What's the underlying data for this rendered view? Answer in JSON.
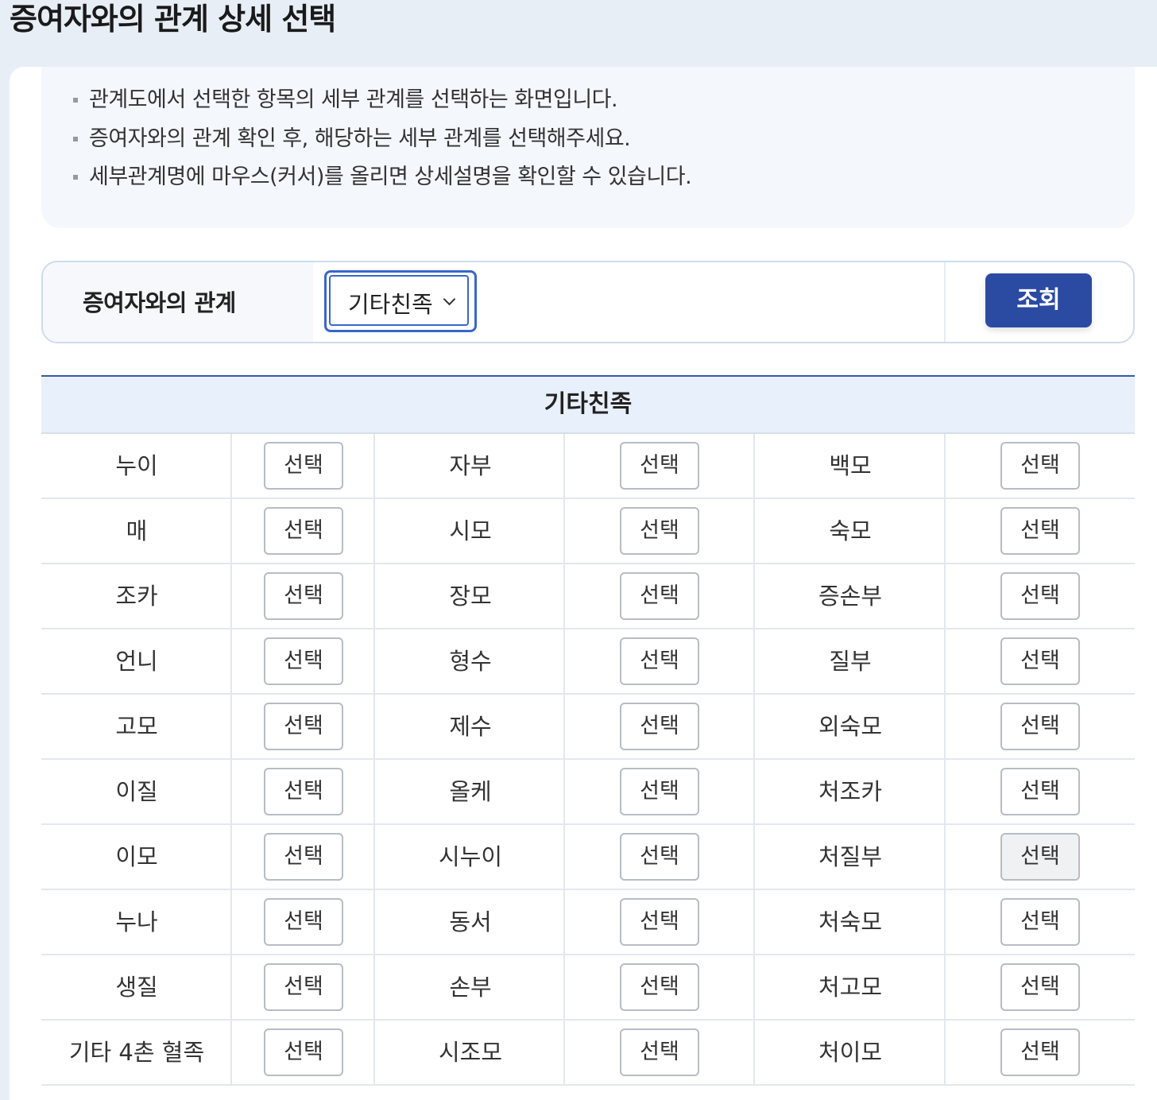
{
  "page": {
    "title": "증여자와의 관계 상세 선택"
  },
  "guide": {
    "items": [
      "관계도에서 선택한 항목의 세부 관계를 선택하는 화면입니다.",
      "증여자와의 관계 확인 후, 해당하는 세부 관계를 선택해주세요.",
      "세부관계명에 마우스(커서)를 올리면 상세설명을 확인할 수 있습니다."
    ]
  },
  "search": {
    "label": "증여자와의 관계",
    "select_value": "기타친족",
    "button_label": "조회"
  },
  "table": {
    "header": "기타친족",
    "select_label": "선택",
    "rows": [
      [
        "누이",
        "자부",
        "백모"
      ],
      [
        "매",
        "시모",
        "숙모"
      ],
      [
        "조카",
        "장모",
        "증손부"
      ],
      [
        "언니",
        "형수",
        "질부"
      ],
      [
        "고모",
        "제수",
        "외숙모"
      ],
      [
        "이질",
        "올케",
        "처조카"
      ],
      [
        "이모",
        "시누이",
        "처질부"
      ],
      [
        "누나",
        "동서",
        "처숙모"
      ],
      [
        "생질",
        "손부",
        "처고모"
      ],
      [
        "기타 4촌 혈족",
        "시조모",
        "처이모"
      ]
    ]
  }
}
